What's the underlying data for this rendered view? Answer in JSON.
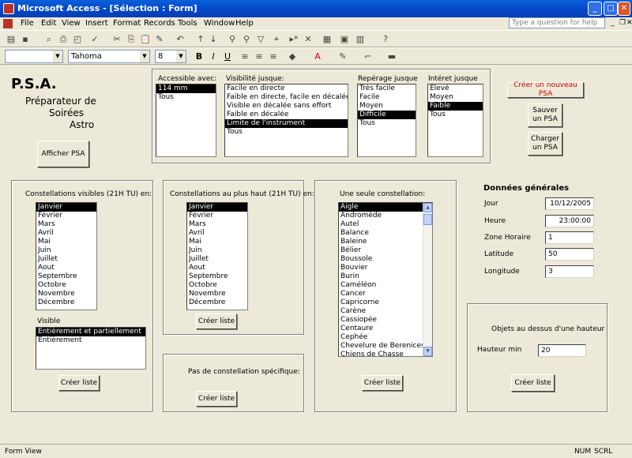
{
  "window": {
    "title": "Microsoft Access - [Sélection : Form]"
  },
  "menu": [
    "File",
    "Edit",
    "View",
    "Insert",
    "Format",
    "Records",
    "Tools",
    "Window",
    "Help"
  ],
  "question_box": {
    "placeholder": "Type a question for help"
  },
  "format_toolbar": {
    "object_value": "",
    "font": "Tahoma",
    "size": "8",
    "bold": "B",
    "italic": "I",
    "underline": "U"
  },
  "header": {
    "logo": "P.S.A.",
    "subtitle_1": "Préparateur de",
    "subtitle_2": "Soirées",
    "subtitle_3": "Astro",
    "show_button": "Afficher PSA"
  },
  "filters": {
    "accessible": {
      "label": "Accessible avec:",
      "items": [
        "114 mm",
        "Tous"
      ],
      "selected": 0
    },
    "visibilite": {
      "label": "Visibilité jusque:",
      "items": [
        "Facile en directe",
        "Faible en directe, facile en décalée",
        "Visible en décalée sans effort",
        "Faible en décalée",
        "Limite de l'instrument",
        "Tous"
      ],
      "selected": 4
    },
    "reperage": {
      "label": "Repérage jusque",
      "items": [
        "Très facile",
        "Facile",
        "Moyen",
        "Difficile",
        "Tous"
      ],
      "selected": 3
    },
    "interet": {
      "label": "Intéret jusque",
      "items": [
        "Elevé",
        "Moyen",
        "Faible",
        "Tous"
      ],
      "selected": 2
    }
  },
  "actions": {
    "create": "Créer un nouveau PSA",
    "save": "Sauver\nun PSA",
    "load": "Charger\nun PSA",
    "create_color": "#cc0000"
  },
  "visible_const": {
    "label": "Constellations visibles (21H TU)  en:",
    "months": [
      "Janvier",
      "Février",
      "Mars",
      "Avril",
      "Mai",
      "Juin",
      "Juillet",
      "Aout",
      "Septembre",
      "Octobre",
      "Novembre",
      "Décembre"
    ],
    "selected": 0,
    "visible_label": "Visible",
    "visible_items": [
      "Entièrement et partiellement",
      "Entièrement"
    ],
    "visible_selected": 0,
    "button": "Créer liste"
  },
  "highest_const": {
    "label": "Constellations au plus haut (21H TU)  en:",
    "months": [
      "Janvier",
      "Février",
      "Mars",
      "Avril",
      "Mai",
      "Juin",
      "Juillet",
      "Aout",
      "Septembre",
      "Octobre",
      "Novembre",
      "Décembre"
    ],
    "selected": 0,
    "button": "Créer liste"
  },
  "no_const": {
    "label": "Pas de constellation spécifique:",
    "button": "Créer liste"
  },
  "single_const": {
    "label": "Une seule constellation:",
    "items": [
      "Aigle",
      "Andromède",
      "Autel",
      "Balance",
      "Baleine",
      "Bélier",
      "Boussole",
      "Bouvier",
      "Burin",
      "Caméléon",
      "Cancer",
      "Capricorne",
      "Carène",
      "Cassiopée",
      "Centaure",
      "Cephée",
      "Chevelure de Berenices",
      "Chiens de Chasse"
    ],
    "selected": 0,
    "button": "Créer liste"
  },
  "general": {
    "title": "Données générales",
    "fields": [
      {
        "label": "Jour",
        "value": "10/12/2005",
        "align": "right"
      },
      {
        "label": "Heure",
        "value": "23:00:00",
        "align": "right"
      },
      {
        "label": "Zone Horaire",
        "value": "1",
        "align": "left"
      },
      {
        "label": "Latitude",
        "value": "50",
        "align": "left"
      },
      {
        "label": "Longitude",
        "value": "3",
        "align": "left"
      }
    ]
  },
  "height_objects": {
    "title": "Objets au dessus d'une hauteur",
    "label": "Hauteur min",
    "value": "20",
    "button": "Créer liste"
  },
  "status": {
    "left": "Form View",
    "num": "NUM",
    "scrl": "SCRL"
  }
}
